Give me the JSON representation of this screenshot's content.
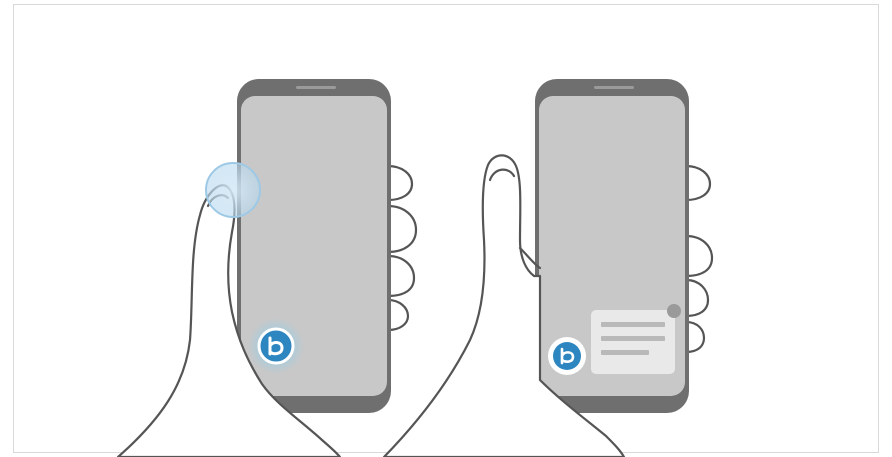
{
  "illustration": {
    "panels": [
      {
        "name": "press-side-key",
        "icon": "bixby-icon"
      },
      {
        "name": "bixby-voice-popup",
        "icon": "bixby-icon",
        "popup_lines": 3
      }
    ]
  },
  "colors": {
    "phone_body": "#6f6f6f",
    "phone_screen": "#c8c8c8",
    "hand_outline": "#555555",
    "hand_fill": "#ffffff",
    "accent_blue": "#2e86c1",
    "glow_blue": "#8fd0ee",
    "touch_circle": "#9ec9e6",
    "popup_bg": "#e9e9e9",
    "popup_lines": "#b9b9b9"
  }
}
